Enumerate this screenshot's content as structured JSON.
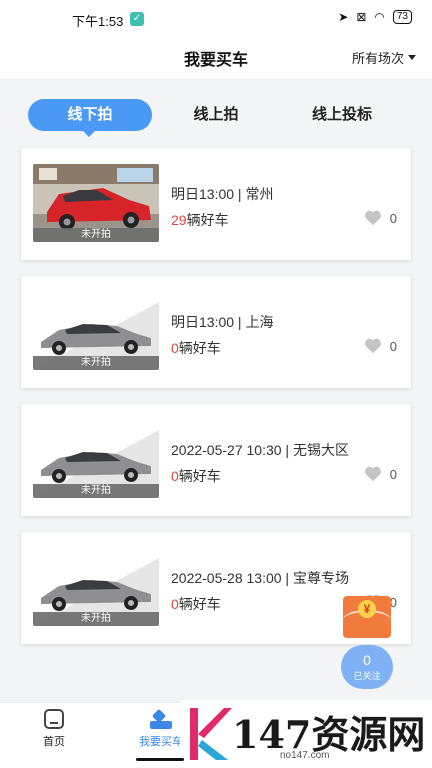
{
  "status": {
    "time": "下午1:53",
    "battery": "73"
  },
  "nav": {
    "title": "我要买车",
    "filter": "所有场次"
  },
  "tabs": [
    {
      "label": "线下拍",
      "active": true
    },
    {
      "label": "线上拍",
      "active": false
    },
    {
      "label": "线上投标",
      "active": false
    }
  ],
  "cards": [
    {
      "when": "明日13:00 | 常州",
      "count": "29",
      "count_suffix": "辆好车",
      "likes": "0",
      "thumb_label": "未开拍",
      "thumb": "red-car-photo"
    },
    {
      "when": "明日13:00 | 上海",
      "count": "0",
      "count_suffix": "辆好车",
      "likes": "0",
      "thumb_label": "未开拍",
      "thumb": "silver-sedan-photo"
    },
    {
      "when": "2022-05-27 10:30 | 无锡大区",
      "count": "0",
      "count_suffix": "辆好车",
      "likes": "0",
      "thumb_label": "未开拍",
      "thumb": "silver-sedan-photo"
    },
    {
      "when": "2022-05-28 13:00 | 宝尊专场",
      "count": "0",
      "count_suffix": "辆好车",
      "likes": "0",
      "thumb_label": "未开拍",
      "thumb": "silver-sedan-photo"
    }
  ],
  "redpack": {
    "symbol": "¥"
  },
  "follow": {
    "count": "0",
    "label": "已关注"
  },
  "bottom_nav": {
    "home": "首页",
    "buy": "我要买车"
  },
  "watermark": {
    "text": "147资源网",
    "url": "no147.com"
  },
  "colors": {
    "accent": "#4a9af5",
    "count_red": "#e0473b",
    "redpack": "#f07b3c"
  }
}
